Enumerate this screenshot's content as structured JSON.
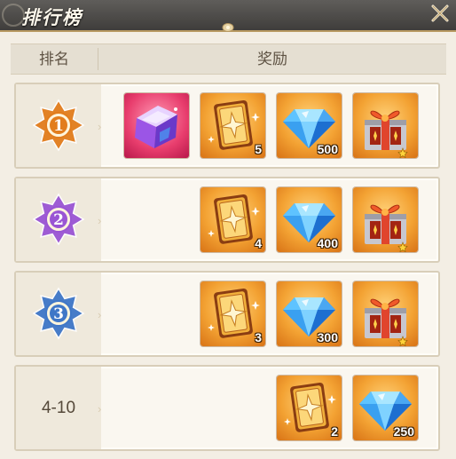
{
  "window": {
    "title": "排行榜"
  },
  "header": {
    "rank_label": "排名",
    "reward_label": "奖励"
  },
  "rows": [
    {
      "rank": "1",
      "medal_color": "#e27d1d",
      "rewards": [
        {
          "icon": "crystal-cube-icon",
          "qty": ""
        },
        {
          "icon": "star-card-icon",
          "qty": "5"
        },
        {
          "icon": "diamond-icon",
          "qty": "500"
        },
        {
          "icon": "gift-box-icon",
          "qty": ""
        }
      ]
    },
    {
      "rank": "2",
      "medal_color": "#9a55d4",
      "rewards": [
        {
          "icon": "star-card-icon",
          "qty": "4"
        },
        {
          "icon": "diamond-icon",
          "qty": "400"
        },
        {
          "icon": "gift-box-icon",
          "qty": ""
        }
      ]
    },
    {
      "rank": "3",
      "medal_color": "#3f77c7",
      "rewards": [
        {
          "icon": "star-card-icon",
          "qty": "3"
        },
        {
          "icon": "diamond-icon",
          "qty": "300"
        },
        {
          "icon": "gift-box-icon",
          "qty": ""
        }
      ]
    },
    {
      "rank": "4-10",
      "medal_color": "",
      "rewards": [
        {
          "icon": "star-card-icon",
          "qty": "2"
        },
        {
          "icon": "diamond-icon",
          "qty": "250"
        }
      ]
    }
  ]
}
